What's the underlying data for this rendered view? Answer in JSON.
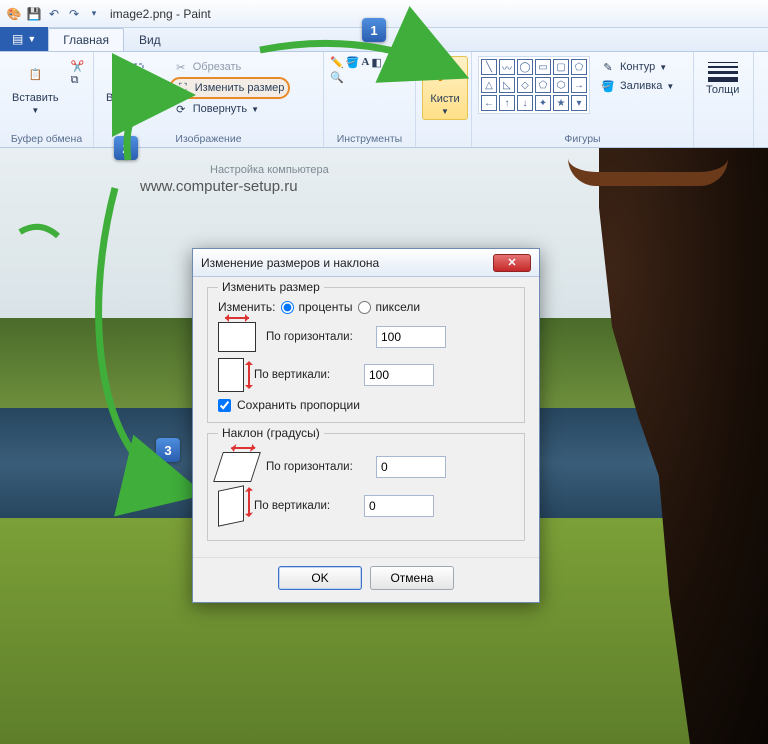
{
  "titlebar": {
    "title": "image2.png - Paint"
  },
  "tabs": {
    "home": "Главная",
    "view": "Вид"
  },
  "ribbon": {
    "clipboard": {
      "paste": "Вставить",
      "label": "Буфер обмена"
    },
    "image": {
      "select": "Выделить",
      "crop": "Обрезать",
      "resize": "Изменить размер",
      "rotate": "Повернуть",
      "label": "Изображение"
    },
    "tools": {
      "label": "Инструменты"
    },
    "brushes": {
      "label": "Кисти"
    },
    "shapes": {
      "outline": "Контур",
      "fill": "Заливка",
      "label": "Фигуры"
    },
    "thickness": {
      "label": "Толщи"
    }
  },
  "watermark": {
    "line1": "Настройка компьютера",
    "line2": "www.computer-setup.ru"
  },
  "badges": {
    "b1": "1",
    "b2": "2",
    "b3": "3"
  },
  "dialog": {
    "title": "Изменение размеров и наклона",
    "resize_legend": "Изменить размер",
    "change_by": "Изменить:",
    "percent": "проценты",
    "pixels": "пиксели",
    "horiz": "По горизонтали:",
    "vert": "По вертикали:",
    "h_value": "100",
    "v_value": "100",
    "keep_ratio": "Сохранить пропорции",
    "skew_legend": "Наклон (градусы)",
    "skew_h_value": "0",
    "skew_v_value": "0",
    "ok": "OK",
    "cancel": "Отмена"
  }
}
